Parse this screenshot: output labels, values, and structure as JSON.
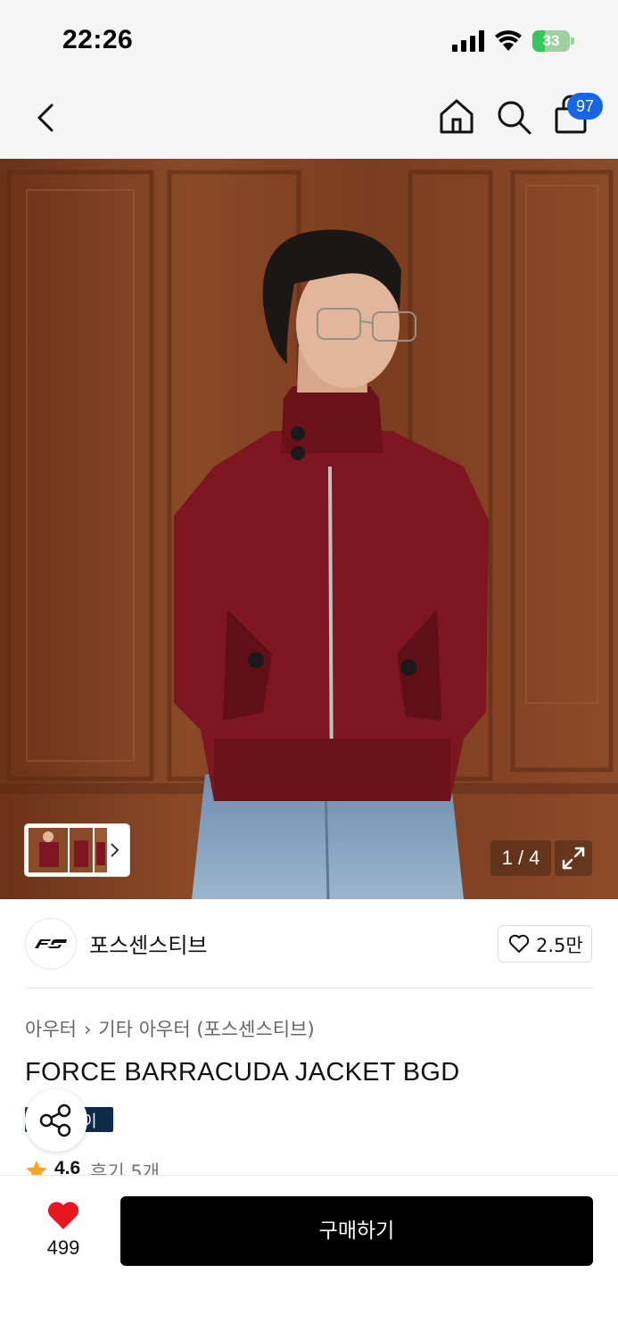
{
  "status_bar": {
    "time": "22:26",
    "battery": "33",
    "battery_level": 0.33
  },
  "nav": {
    "cart_count": "97"
  },
  "product_image": {
    "counter": "1 / 4"
  },
  "brand": {
    "name": "포스센스티브",
    "likes": "2.5만"
  },
  "breadcrumb": {
    "category": "아우터",
    "subcategory": "기타 아우터 (포스센스티브)"
  },
  "product": {
    "title": "FORCE BARRACUDA JACKET BGD",
    "pay_badge": "이",
    "rating": "4.6",
    "reviews": "후기 5개"
  },
  "bottom_bar": {
    "wish_count": "499",
    "buy_label": "구매하기"
  },
  "colors": {
    "accent_blue": "#1565e8",
    "wish_red": "#e8161f",
    "rating_star": "#f6a623",
    "pay_badge_bg": "#0d2a4a"
  }
}
